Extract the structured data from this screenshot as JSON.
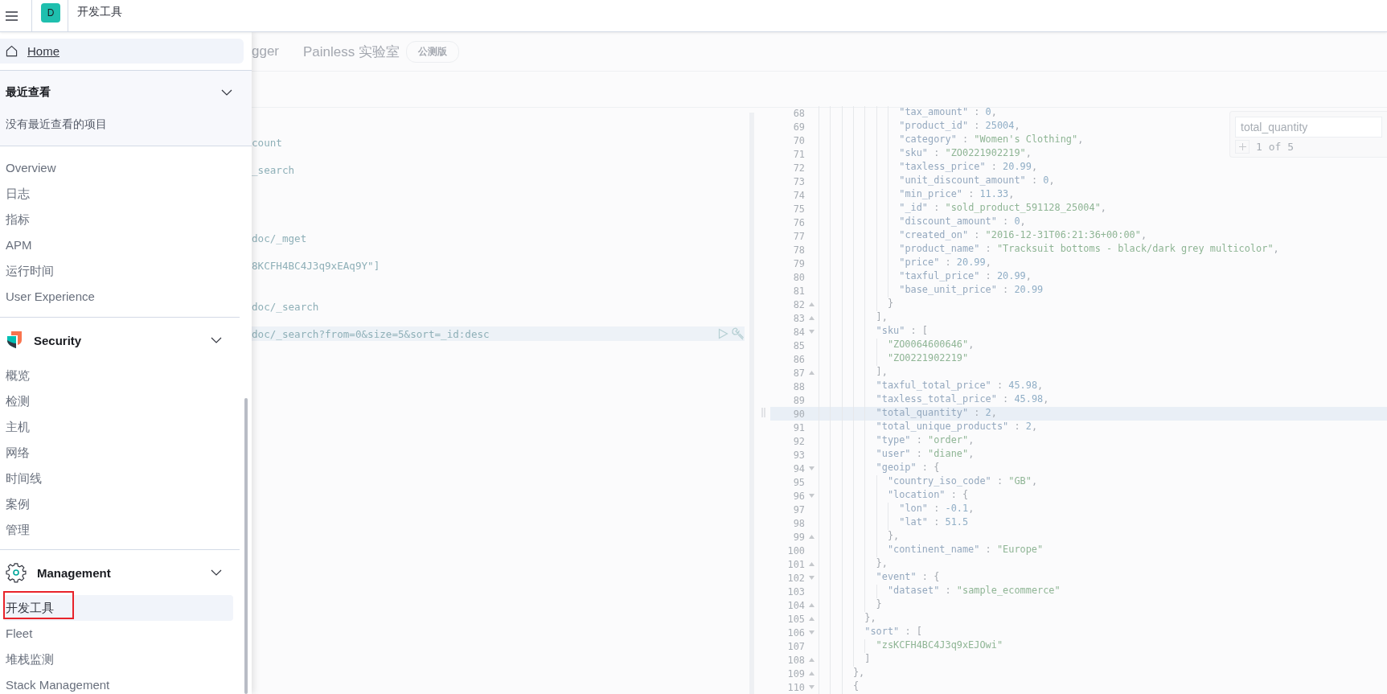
{
  "header": {
    "avatar": "D",
    "title": "开发工具"
  },
  "nav": {
    "home": {
      "label": "Home",
      "selected": true
    },
    "sections": [
      {
        "kind": "recent",
        "title": "最近查看",
        "expanded": true,
        "empty_text": "没有最近查看的项目"
      },
      {
        "kind": "links",
        "items": [
          {
            "label": "Overview",
            "selected": false,
            "marked": false
          },
          {
            "label": "日志",
            "selected": false,
            "marked": false
          },
          {
            "label": "指标",
            "selected": false,
            "marked": false
          },
          {
            "label": "APM",
            "selected": false,
            "marked": false
          },
          {
            "label": "运行时间",
            "selected": false,
            "marked": false
          },
          {
            "label": "User Experience",
            "selected": false,
            "marked": false
          }
        ]
      },
      {
        "kind": "group",
        "title": "Security",
        "expanded": true,
        "items": [
          {
            "label": "概览",
            "selected": false,
            "marked": false
          },
          {
            "label": "检测",
            "selected": false,
            "marked": false
          },
          {
            "label": "主机",
            "selected": false,
            "marked": false
          },
          {
            "label": "网络",
            "selected": false,
            "marked": false
          },
          {
            "label": "时间线",
            "selected": false,
            "marked": false
          },
          {
            "label": "案例",
            "selected": false,
            "marked": false
          },
          {
            "label": "管理",
            "selected": false,
            "marked": false
          }
        ]
      },
      {
        "kind": "group",
        "title": "Management",
        "expanded": true,
        "items": [
          {
            "label": "开发工具",
            "selected": true,
            "marked": true
          },
          {
            "label": "Fleet",
            "selected": false,
            "marked": false
          },
          {
            "label": "堆栈监测",
            "selected": false,
            "marked": false
          },
          {
            "label": "Stack Management",
            "selected": false,
            "marked": false
          }
        ]
      }
    ]
  },
  "tabs": [
    {
      "label": "gger"
    },
    {
      "label": "Painless 实验室",
      "badge": "公测版"
    }
  ],
  "console": {
    "lines": [
      {
        "text": "count",
        "active": false
      },
      {
        "text": "_search",
        "active": false
      },
      {
        "text": "doc/_mget",
        "active": false
      },
      {
        "text": "8KCFH4BC4J3q9xEAq9Y\"]",
        "active": false
      },
      {
        "text": "doc/_search",
        "active": false
      },
      {
        "text": "doc/_search?from=0&size=5&sort=_id:desc",
        "active": true
      }
    ]
  },
  "output": {
    "search": {
      "value": "total_quantity",
      "count": "1 of 5"
    },
    "lines": [
      {
        "n": "68",
        "code": "              \"tax_amount\" : 0,",
        "active": false
      },
      {
        "n": "69",
        "code": "              \"product_id\" : 25004,",
        "active": false
      },
      {
        "n": "70",
        "code": "              \"category\" : \"Women's Clothing\",",
        "active": false
      },
      {
        "n": "71",
        "code": "              \"sku\" : \"ZO0221902219\",",
        "active": false
      },
      {
        "n": "72",
        "code": "              \"taxless_price\" : 20.99,",
        "active": false
      },
      {
        "n": "73",
        "code": "              \"unit_discount_amount\" : 0,",
        "active": false
      },
      {
        "n": "74",
        "code": "              \"min_price\" : 11.33,",
        "active": false
      },
      {
        "n": "75",
        "code": "              \"_id\" : \"sold_product_591128_25004\",",
        "active": false
      },
      {
        "n": "76",
        "code": "              \"discount_amount\" : 0,",
        "active": false
      },
      {
        "n": "77",
        "code": "              \"created_on\" : \"2016-12-31T06:21:36+00:00\",",
        "active": false
      },
      {
        "n": "78",
        "code": "              \"product_name\" : \"Tracksuit bottoms - black/dark grey multicolor\",",
        "active": false
      },
      {
        "n": "79",
        "code": "              \"price\" : 20.99,",
        "active": false
      },
      {
        "n": "80",
        "code": "              \"taxful_price\" : 20.99,",
        "active": false
      },
      {
        "n": "81",
        "code": "              \"base_unit_price\" : 20.99",
        "active": false
      },
      {
        "n": "82",
        "code": "            }",
        "kind": "close",
        "active": false
      },
      {
        "n": "83",
        "code": "          ],",
        "kind": "close",
        "active": false
      },
      {
        "n": "84",
        "code": "          \"sku\" : [",
        "kind": "open",
        "active": false
      },
      {
        "n": "85",
        "code": "            \"ZO0064600646\",",
        "active": false
      },
      {
        "n": "86",
        "code": "            \"ZO0221902219\"",
        "active": false
      },
      {
        "n": "87",
        "code": "          ],",
        "kind": "close",
        "active": false
      },
      {
        "n": "88",
        "code": "          \"taxful_total_price\" : 45.98,",
        "active": false
      },
      {
        "n": "89",
        "code": "          \"taxless_total_price\" : 45.98,",
        "active": false
      },
      {
        "n": "90",
        "code": "          \"total_quantity\" : 2,",
        "active": true
      },
      {
        "n": "91",
        "code": "          \"total_unique_products\" : 2,",
        "active": false
      },
      {
        "n": "92",
        "code": "          \"type\" : \"order\",",
        "active": false
      },
      {
        "n": "93",
        "code": "          \"user\" : \"diane\",",
        "active": false
      },
      {
        "n": "94",
        "code": "          \"geoip\" : {",
        "kind": "open",
        "active": false
      },
      {
        "n": "95",
        "code": "            \"country_iso_code\" : \"GB\",",
        "active": false
      },
      {
        "n": "96",
        "code": "            \"location\" : {",
        "kind": "open",
        "active": false
      },
      {
        "n": "97",
        "code": "              \"lon\" : -0.1,",
        "active": false
      },
      {
        "n": "98",
        "code": "              \"lat\" : 51.5",
        "active": false
      },
      {
        "n": "99",
        "code": "            },",
        "kind": "close",
        "active": false
      },
      {
        "n": "100",
        "code": "            \"continent_name\" : \"Europe\"",
        "active": false
      },
      {
        "n": "101",
        "code": "          },",
        "kind": "close",
        "active": false
      },
      {
        "n": "102",
        "code": "          \"event\" : {",
        "kind": "open",
        "active": false
      },
      {
        "n": "103",
        "code": "            \"dataset\" : \"sample_ecommerce\"",
        "active": false
      },
      {
        "n": "104",
        "code": "          }",
        "kind": "close",
        "active": false
      },
      {
        "n": "105",
        "code": "        },",
        "kind": "close",
        "active": false
      },
      {
        "n": "106",
        "code": "        \"sort\" : [",
        "kind": "open",
        "active": false
      },
      {
        "n": "107",
        "code": "          \"zsKCFH4BC4J3q9xEJOwi\"",
        "active": false
      },
      {
        "n": "108",
        "code": "        ]",
        "kind": "close",
        "active": false
      },
      {
        "n": "109",
        "code": "      },",
        "kind": "close",
        "active": false
      },
      {
        "n": "110",
        "code": "      {",
        "kind": "open",
        "active": false
      }
    ]
  }
}
